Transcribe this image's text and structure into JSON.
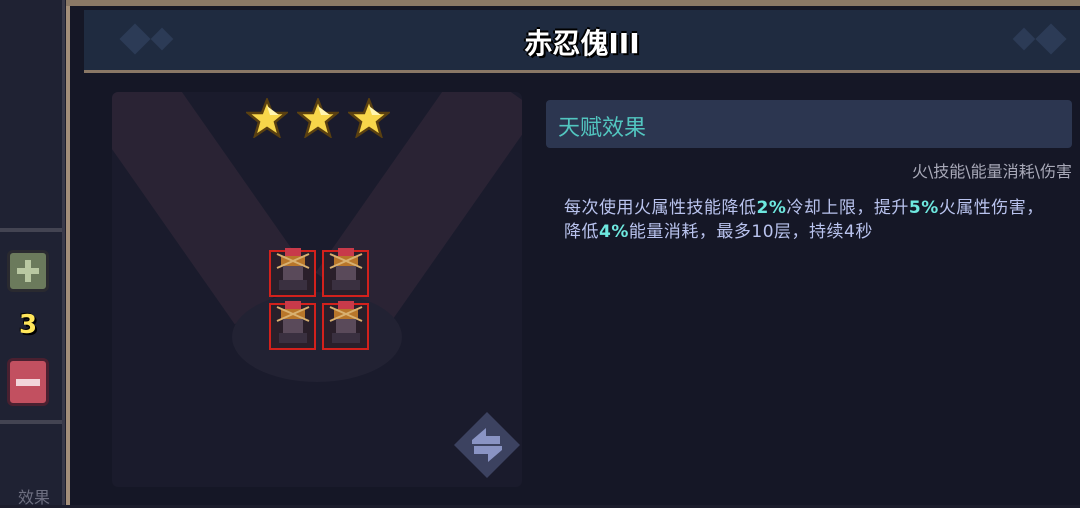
{
  "sidebar": {
    "count": "3",
    "bottom_label": "效果",
    "plus_icon": "plus-icon",
    "minus_icon": "minus-icon"
  },
  "title": "赤忍傀III",
  "stars": {
    "filled": 3,
    "total": 3,
    "color": "#f7d64a"
  },
  "talent": {
    "header": "天赋效果",
    "tags": "火\\技能\\能量消耗\\伤害",
    "desc": {
      "p1": "每次使用火属性技能降低",
      "v1": "2%",
      "p2": "冷却上限，提升",
      "v2": "5%",
      "p3": "火属性伤害，降低",
      "v3": "4%",
      "p4": "能量消耗，最多10层，持续4秒"
    }
  },
  "units": {
    "count": 4,
    "border_color": "#d3211c"
  },
  "swap_icon": "swap-icon",
  "colors": {
    "accent": "#52c6c0",
    "highlight": "#6ee8df",
    "frame": "#a48f7a"
  }
}
